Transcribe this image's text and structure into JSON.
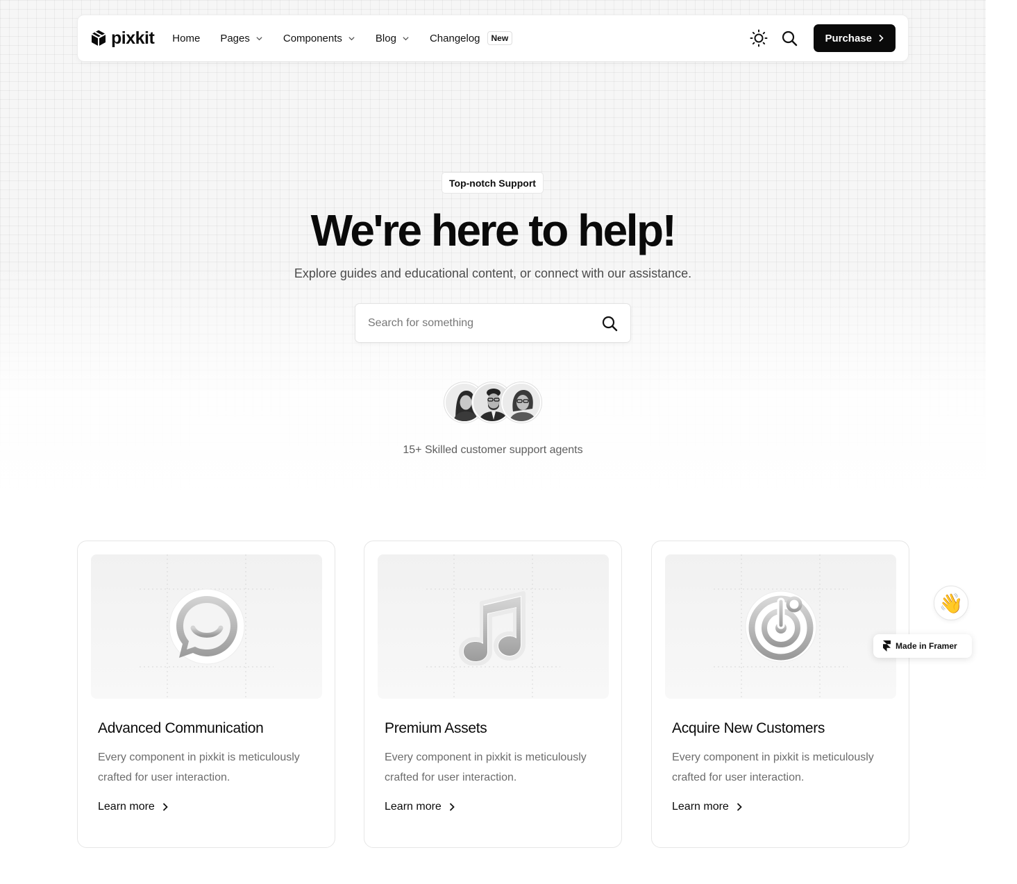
{
  "nav": {
    "logo_text": "pixkit",
    "items": [
      {
        "label": "Home"
      },
      {
        "label": "Pages"
      },
      {
        "label": "Components"
      },
      {
        "label": "Blog"
      },
      {
        "label": "Changelog",
        "badge": "New"
      }
    ],
    "purchase_label": "Purchase"
  },
  "hero": {
    "tag": "Top-notch Support",
    "title": "We're here to help!",
    "subtitle": "Explore guides and educational content, or connect with our assistance.",
    "search_placeholder": "Search for something",
    "agents_text": "15+ Skilled customer support agents"
  },
  "cards": [
    {
      "icon": "chat-bubble-icon",
      "title": "Advanced Communication",
      "description": "Every component in pixkit is meticulously crafted for user interaction.",
      "link": "Learn more"
    },
    {
      "icon": "music-note-icon",
      "title": "Premium Assets",
      "description": "Every component in pixkit is meticulously crafted for user interaction.",
      "link": "Learn more"
    },
    {
      "icon": "target-icon",
      "title": "Acquire New Customers",
      "description": "Every component in pixkit is meticulously crafted for user interaction.",
      "link": "Learn more"
    }
  ],
  "floating": {
    "wave_emoji": "👋",
    "framer_badge": "Made in Framer"
  },
  "colors": {
    "primary": "#0a0a0a",
    "muted_text": "#6c6c6c",
    "border": "#e6e6e6",
    "hero_bg": "#f6f6f6"
  }
}
